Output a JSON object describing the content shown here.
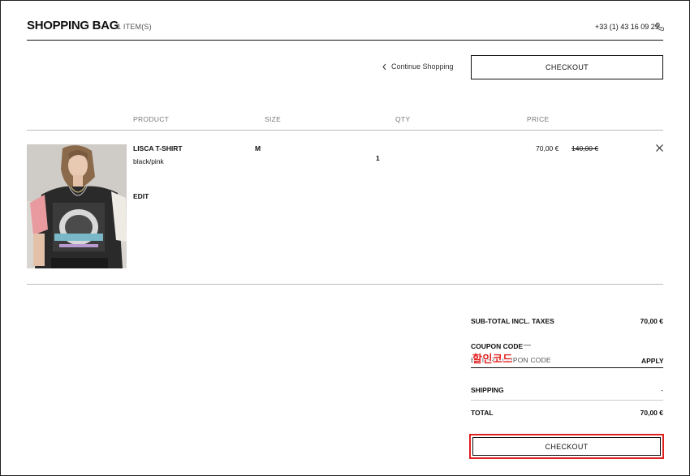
{
  "header": {
    "title": "SHOPPING BAG",
    "item_count": "1 ITEM(S)",
    "phone": "+33 (1) 43 16 09 29"
  },
  "actions": {
    "continue_shopping": "Continue Shopping",
    "checkout_top": "CHECKOUT"
  },
  "table": {
    "columns": [
      "PRODUCT",
      "SIZE",
      "QTY",
      "PRICE"
    ]
  },
  "items": [
    {
      "name": "LISCA T-SHIRT",
      "color": "black/pink",
      "edit": "EDIT",
      "size": "M",
      "qty": "1",
      "price": "70,00 €",
      "original_price": "140,00 €"
    }
  ],
  "summary": {
    "subtotal_label": "SUB-TOTAL INCL. TAXES",
    "subtotal_value": "70,00 €",
    "coupon_label": "COUPON CODE",
    "coupon_dash": "—",
    "coupon_placeholder": "ENTER COUPON CODE",
    "coupon_apply": "APPLY",
    "stamp_text": "할인코드",
    "shipping_label": "SHIPPING",
    "shipping_value": "-",
    "total_label": "TOTAL",
    "total_value": "70,00 €",
    "checkout_bottom": "CHECKOUT"
  },
  "colors": {
    "highlight": "#e01f1f",
    "text": "#111111"
  }
}
